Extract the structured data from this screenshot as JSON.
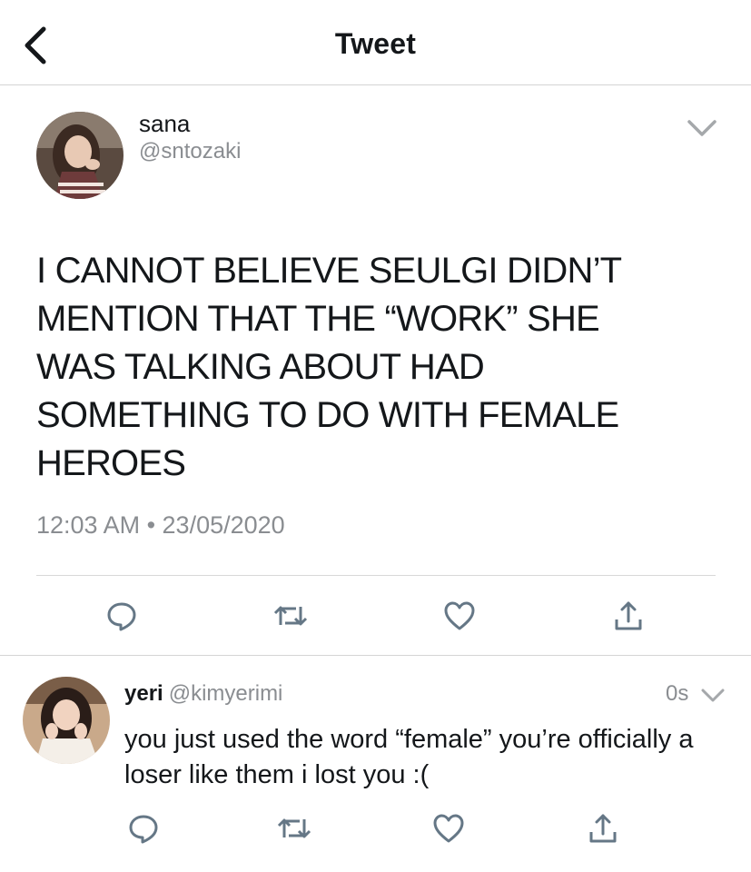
{
  "header": {
    "title": "Tweet"
  },
  "tweet": {
    "author_name": "sana",
    "author_handle": "@sntozaki",
    "text_lines": [
      "I CANNOT BELIEVE SEULGI DIDN’T",
      "MENTION THAT THE “WORK” SHE",
      "WAS TALKING ABOUT HAD",
      "SOMETHING TO DO WITH FEMALE",
      "HEROES"
    ],
    "timestamp": "12:03 AM • 23/05/2020"
  },
  "reply": {
    "author_name": "yeri",
    "author_handle": "@kimyerimi",
    "time": "0s",
    "text": "you just used the word “female” you’re officially a loser like them i lost you :("
  },
  "icons": {
    "back": "chevron-left-icon",
    "menu": "chevron-down-icon",
    "reply": "comment-icon",
    "retweet": "retweet-icon",
    "like": "heart-icon",
    "share": "share-icon"
  },
  "colors": {
    "text": "#14171a",
    "secondary": "#8a8d91",
    "icon": "#657786",
    "divider": "#d4d4d4"
  }
}
